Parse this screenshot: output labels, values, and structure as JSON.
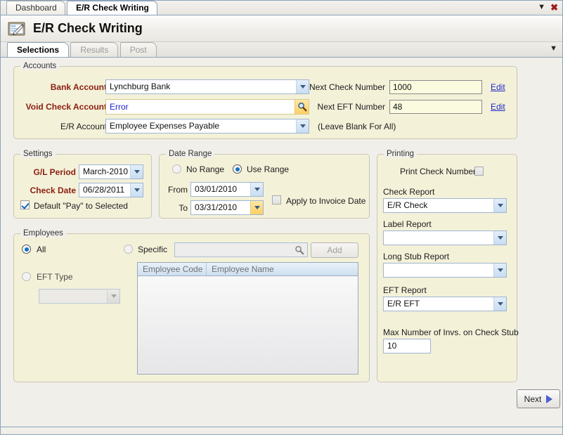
{
  "window": {
    "tabs": [
      {
        "label": "Dashboard",
        "active": false
      },
      {
        "label": "E/R Check Writing",
        "active": true
      }
    ],
    "dropdown_icon": "chevron-down-icon",
    "close_icon": "close-icon"
  },
  "header": {
    "title": "E/R Check Writing",
    "icon": "check-writing-icon"
  },
  "page_tabs": {
    "items": [
      {
        "label": "Selections",
        "active": true,
        "enabled": true
      },
      {
        "label": "Results",
        "active": false,
        "enabled": false
      },
      {
        "label": "Post",
        "active": false,
        "enabled": false
      }
    ],
    "overflow_icon": "chevron-down-icon"
  },
  "accounts": {
    "title": "Accounts",
    "bank_account": {
      "label": "Bank Account",
      "value": "Lynchburg Bank",
      "required": true
    },
    "void_check_account": {
      "label": "Void Check Account",
      "value": "Error",
      "required": true,
      "lookup_icon": "magnifier-icon"
    },
    "er_account": {
      "label": "E/R Account",
      "value": "Employee Expenses Payable",
      "hint": "(Leave Blank For All)"
    },
    "next_check_number": {
      "label": "Next Check Number",
      "value": "1000",
      "edit_label": "Edit"
    },
    "next_eft_number": {
      "label": "Next EFT Number",
      "value": "48",
      "edit_label": "Edit"
    }
  },
  "settings": {
    "title": "Settings",
    "gl_period": {
      "label": "G/L Period",
      "value": "March-2010"
    },
    "check_date": {
      "label": "Check Date",
      "value": "06/28/2011"
    },
    "default_pay": {
      "label": "Default \"Pay\"  to Selected",
      "checked": true
    }
  },
  "date_range": {
    "title": "Date Range",
    "no_range": {
      "label": "No Range",
      "selected": false
    },
    "use_range": {
      "label": "Use Range",
      "selected": true
    },
    "from": {
      "label": "From",
      "value": "03/01/2010"
    },
    "to": {
      "label": "To",
      "value": "03/31/2010"
    },
    "apply_invoice_date": {
      "label": "Apply to Invoice Date",
      "checked": false
    }
  },
  "printing": {
    "title": "Printing",
    "print_check_number": {
      "label": "Print Check Number",
      "checked": false
    },
    "check_report": {
      "label": "Check Report",
      "value": "E/R Check"
    },
    "label_report": {
      "label": "Label Report",
      "value": ""
    },
    "long_stub_report": {
      "label": "Long Stub Report",
      "value": ""
    },
    "eft_report": {
      "label": "EFT Report",
      "value": "E/R EFT"
    },
    "max_invs": {
      "label": "Max Number of Invs. on Check Stub",
      "value": "10"
    }
  },
  "employees": {
    "title": "Employees",
    "all": {
      "label": "All",
      "selected": true
    },
    "eft_type": {
      "label": "EFT Type",
      "selected": false,
      "value": ""
    },
    "specific": {
      "label": "Specific",
      "selected": false,
      "value": "",
      "search_icon": "magnifier-icon"
    },
    "add_button": {
      "label": "Add",
      "enabled": false
    },
    "grid": {
      "columns": [
        "Employee Code",
        "Employee Name"
      ],
      "rows": []
    }
  },
  "footer": {
    "next_button": {
      "label": "Next",
      "icon": "triangle-right-icon"
    }
  },
  "colors": {
    "panel_bg": "#f4f1d9",
    "required_label": "#8a1f10",
    "link": "#1b28c8",
    "accent_blue": "#1272c4",
    "error_text": "#2222cc"
  }
}
